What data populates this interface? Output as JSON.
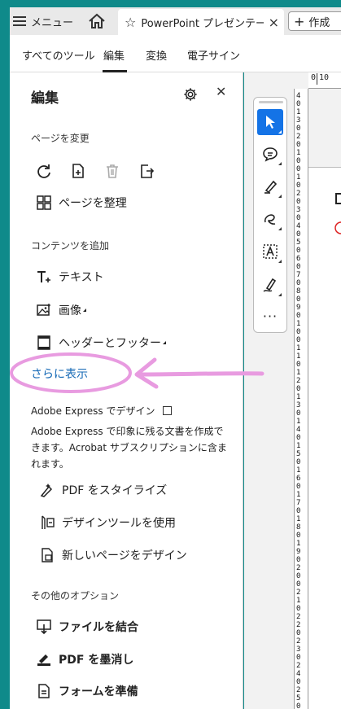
{
  "tabbar": {
    "menu_label": "メニュー",
    "tab_title": "PowerPoint プレゼンテーション",
    "close_glyph": "×",
    "new_label": "作成"
  },
  "nav": {
    "items": [
      "すべてのツール",
      "編集",
      "変換",
      "電子サイン"
    ],
    "active": "編集"
  },
  "panel": {
    "title": "編集",
    "page_change_heading": "ページを変更",
    "organize_label": "ページを整理",
    "add_content_heading": "コンテンツを追加",
    "text_label": "テキスト",
    "image_label": "画像",
    "header_footer_label": "ヘッダーとフッター",
    "more_link": "さらに表示",
    "express_heading": "Adobe Express でデザイン",
    "express_desc": "Adobe Express で印象に残る文書を作成できます。Acrobat サブスクリプションに含まれます。",
    "stylize_label": "PDF をスタイライズ",
    "design_tools_label": "デザインツールを使用",
    "new_page_label": "新しいページをデザイン",
    "other_heading": "その他のオプション",
    "combine_label": "ファイルを結合",
    "redact_label": "PDF を墨消し",
    "form_label": "フォームを準備"
  },
  "ruler": {
    "h_marks": [
      "0",
      "10"
    ],
    "v_marks": [
      "4",
      "0",
      "1",
      "3",
      "0",
      "2",
      "0",
      "1",
      "0",
      "0",
      "1",
      "0",
      "2",
      "0",
      "3",
      "0",
      "4",
      "0",
      "5",
      "0",
      "6",
      "0",
      "7",
      "0",
      "8",
      "0",
      "9",
      "0",
      "1",
      "0",
      "0",
      "1",
      "1",
      "0",
      "1",
      "2",
      "0",
      "1",
      "3",
      "0",
      "1",
      "4",
      "0",
      "1",
      "5",
      "0",
      "1",
      "6",
      "0",
      "1",
      "7",
      "0",
      "1",
      "8",
      "0",
      "1",
      "9",
      "0",
      "2",
      "0",
      "0",
      "2",
      "1",
      "0",
      "2",
      "2",
      "0",
      "2",
      "3",
      "0",
      "2",
      "4",
      "0",
      "2",
      "5",
      "0",
      "2",
      "6",
      "0"
    ]
  },
  "colors": {
    "accent": "#1473e6",
    "link": "#1468b5",
    "annotation": "#e89be0",
    "background": "#0f8a8a"
  }
}
